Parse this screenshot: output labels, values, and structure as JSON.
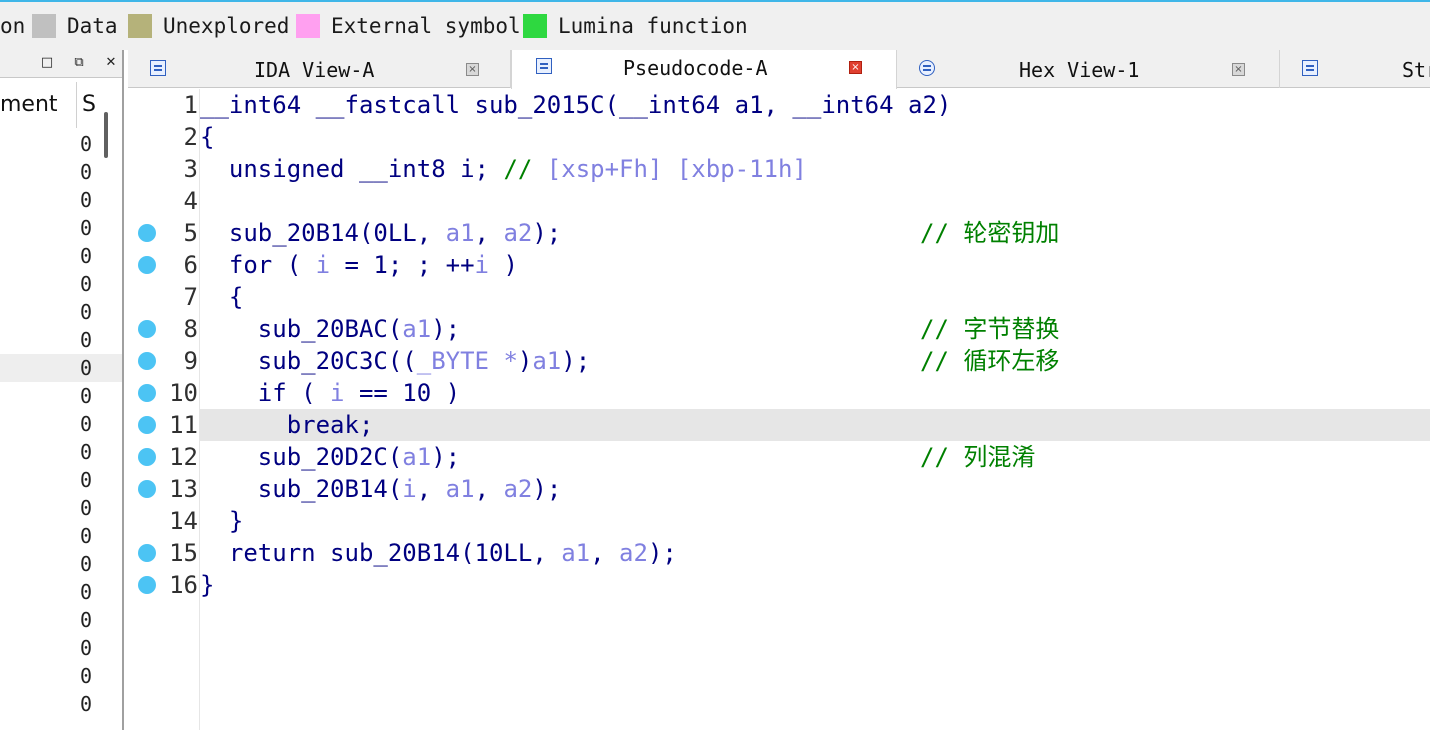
{
  "legend": [
    {
      "label": "on",
      "color": ""
    },
    {
      "label": "Data",
      "color": "#c0c0c0"
    },
    {
      "label": "Unexplored",
      "color": "#b5b27a"
    },
    {
      "label": "External symbol",
      "color": "#ffa0f0"
    },
    {
      "label": "Lumina function",
      "color": "#2ed840"
    }
  ],
  "left_panel": {
    "column_header": "ment",
    "column_header_2": "S",
    "row_value": "0",
    "row_count": 21,
    "highlighted_row": 8
  },
  "tabs": [
    {
      "label": "IDA View-A",
      "icon": "disassembly-view-icon",
      "active": false
    },
    {
      "label": "Pseudocode-A",
      "icon": "pseudocode-icon",
      "active": true
    },
    {
      "label": "Hex View-1",
      "icon": "hex-view-icon",
      "active": false
    },
    {
      "label": "Str",
      "icon": "strings-view-icon",
      "active": false
    }
  ],
  "code": {
    "highlighted_line": 11,
    "lines": [
      {
        "n": "1",
        "dot": false,
        "tokens": [
          [
            "k",
            "__int64 __fastcall sub_2015C(__int64 a1, __int64 a2)"
          ]
        ],
        "comment": ""
      },
      {
        "n": "2",
        "dot": false,
        "tokens": [
          [
            "k",
            "{"
          ]
        ],
        "comment": ""
      },
      {
        "n": "3",
        "dot": false,
        "tokens": [
          [
            "k",
            "  unsigned __int8 i; "
          ],
          [
            "c",
            "// "
          ],
          [
            "v",
            "[xsp+Fh] [xbp-11h]"
          ]
        ],
        "comment": ""
      },
      {
        "n": "4",
        "dot": false,
        "tokens": [],
        "comment": ""
      },
      {
        "n": "5",
        "dot": true,
        "tokens": [
          [
            "k",
            "  sub_20B14(0LL, "
          ],
          [
            "v",
            "a1"
          ],
          [
            "k",
            ", "
          ],
          [
            "v",
            "a2"
          ],
          [
            "k",
            ");"
          ]
        ],
        "comment": "// 轮密钥加"
      },
      {
        "n": "6",
        "dot": true,
        "tokens": [
          [
            "k",
            "  for ( "
          ],
          [
            "v",
            "i"
          ],
          [
            "k",
            " = 1; ; ++"
          ],
          [
            "v",
            "i"
          ],
          [
            "k",
            " )"
          ]
        ],
        "comment": ""
      },
      {
        "n": "7",
        "dot": false,
        "tokens": [
          [
            "k",
            "  {"
          ]
        ],
        "comment": ""
      },
      {
        "n": "8",
        "dot": true,
        "tokens": [
          [
            "k",
            "    sub_20BAC("
          ],
          [
            "v",
            "a1"
          ],
          [
            "k",
            ");"
          ]
        ],
        "comment": "// 字节替换"
      },
      {
        "n": "9",
        "dot": true,
        "tokens": [
          [
            "k",
            "    sub_20C3C(("
          ],
          [
            "v",
            "_BYTE *"
          ],
          [
            "k",
            ")"
          ],
          [
            "v",
            "a1"
          ],
          [
            "k",
            ");"
          ]
        ],
        "comment": "// 循环左移"
      },
      {
        "n": "10",
        "dot": true,
        "tokens": [
          [
            "k",
            "    if ( "
          ],
          [
            "v",
            "i"
          ],
          [
            "k",
            " == 10 )"
          ]
        ],
        "comment": ""
      },
      {
        "n": "11",
        "dot": true,
        "tokens": [
          [
            "k",
            "      break;"
          ]
        ],
        "comment": ""
      },
      {
        "n": "12",
        "dot": true,
        "tokens": [
          [
            "k",
            "    sub_20D2C("
          ],
          [
            "v",
            "a1"
          ],
          [
            "k",
            ");"
          ]
        ],
        "comment": "// 列混淆"
      },
      {
        "n": "13",
        "dot": true,
        "tokens": [
          [
            "k",
            "    sub_20B14("
          ],
          [
            "v",
            "i"
          ],
          [
            "k",
            ", "
          ],
          [
            "v",
            "a1"
          ],
          [
            "k",
            ", "
          ],
          [
            "v",
            "a2"
          ],
          [
            "k",
            ");"
          ]
        ],
        "comment": ""
      },
      {
        "n": "14",
        "dot": false,
        "tokens": [
          [
            "k",
            "  }"
          ]
        ],
        "comment": ""
      },
      {
        "n": "15",
        "dot": true,
        "tokens": [
          [
            "k",
            "  return sub_20B14(10LL, "
          ],
          [
            "v",
            "a1"
          ],
          [
            "k",
            ", "
          ],
          [
            "v",
            "a2"
          ],
          [
            "k",
            ");"
          ]
        ],
        "comment": ""
      },
      {
        "n": "16",
        "dot": true,
        "tokens": [
          [
            "k",
            "}"
          ]
        ],
        "comment": ""
      }
    ]
  }
}
